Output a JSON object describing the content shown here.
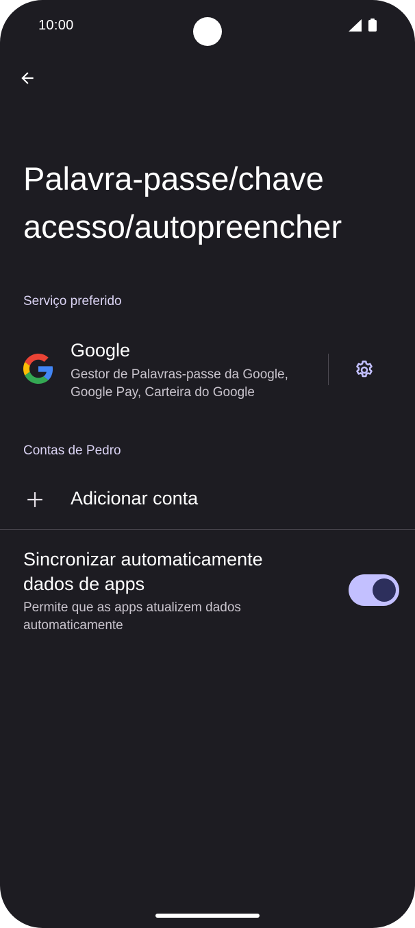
{
  "status_bar": {
    "time": "10:00"
  },
  "header": {
    "back_icon": "arrow-back-icon",
    "title": "Palavra-passe/chave acesso/autopreencher"
  },
  "preferred_service": {
    "section_label": "Serviço preferido",
    "name": "Google",
    "description": "Gestor de Palavras-passe da Google, Google Pay, Carteira do Google",
    "settings_icon": "gear-icon"
  },
  "accounts": {
    "section_label": "Contas de Pedro",
    "add_label": "Adicionar conta",
    "add_icon": "plus-icon"
  },
  "auto_sync": {
    "title": "Sincronizar automaticamente dados de apps",
    "description": "Permite que as apps atualizem dados automaticamente",
    "enabled": true
  },
  "colors": {
    "background": "#1d1c22",
    "accent": "#c3c0ff",
    "section_label": "#d9d2f2"
  }
}
